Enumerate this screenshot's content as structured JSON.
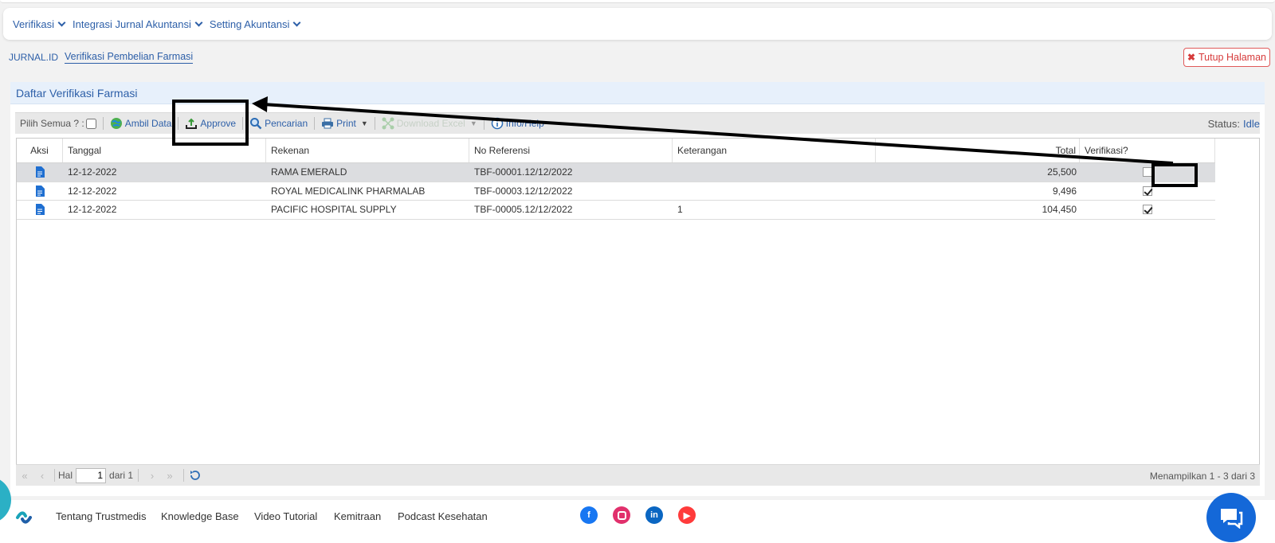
{
  "menu": {
    "items": [
      {
        "label": "Verifikasi"
      },
      {
        "label": "Integrasi Jurnal Akuntansi"
      },
      {
        "label": "Setting Akuntansi"
      }
    ]
  },
  "breadcrumb": {
    "root": "JURNAL.ID",
    "current": "Verifikasi Pembelian Farmasi"
  },
  "close_page_label": "Tutup Halaman",
  "panel_title": "Daftar Verifikasi Farmasi",
  "toolbar": {
    "select_all_label": "Pilih Semua ? :",
    "fetch_label": "Ambil Data",
    "approve_label": "Approve",
    "search_label": "Pencarian",
    "print_label": "Print",
    "download_label": "Download Excel",
    "info_label": "Info/Help",
    "status_label": "Status:",
    "status_value": "Idle"
  },
  "table": {
    "headers": [
      "Aksi",
      "Tanggal",
      "Rekenan",
      "No Referensi",
      "Keterangan",
      "Total",
      "Verifikasi?"
    ],
    "rows": [
      {
        "tanggal": "12-12-2022",
        "rekenan": "RAMA EMERALD",
        "ref": "TBF-00001.12/12/2022",
        "ket": "",
        "total": "25,500",
        "verified": false,
        "selected": true
      },
      {
        "tanggal": "12-12-2022",
        "rekenan": "ROYAL MEDICALINK PHARMALAB",
        "ref": "TBF-00003.12/12/2022",
        "ket": "",
        "total": "9,496",
        "verified": true,
        "selected": false
      },
      {
        "tanggal": "12-12-2022",
        "rekenan": "PACIFIC HOSPITAL SUPPLY",
        "ref": "TBF-00005.12/12/2022",
        "ket": "1",
        "total": "104,450",
        "verified": true,
        "selected": false
      }
    ]
  },
  "pager": {
    "page_label": "Hal",
    "page_value": "1",
    "of_label": "dari 1",
    "info": "Menampilkan 1 - 3 dari 3"
  },
  "footer": {
    "links": [
      "Tentang Trustmedis",
      "Knowledge Base",
      "Video Tutorial",
      "Kemitraan",
      "Podcast Kesehatan"
    ],
    "social": [
      {
        "icon": "facebook-icon",
        "color": "#1877f2"
      },
      {
        "icon": "instagram-icon",
        "color": "#e1306c"
      },
      {
        "icon": "linkedin-icon",
        "color": "#0a66c2"
      },
      {
        "icon": "youtube-icon",
        "color": "#ff3b3b"
      }
    ]
  },
  "colors": {
    "accent": "#2d5fa8",
    "danger": "#d63b3b",
    "chat": "#1468d8"
  }
}
